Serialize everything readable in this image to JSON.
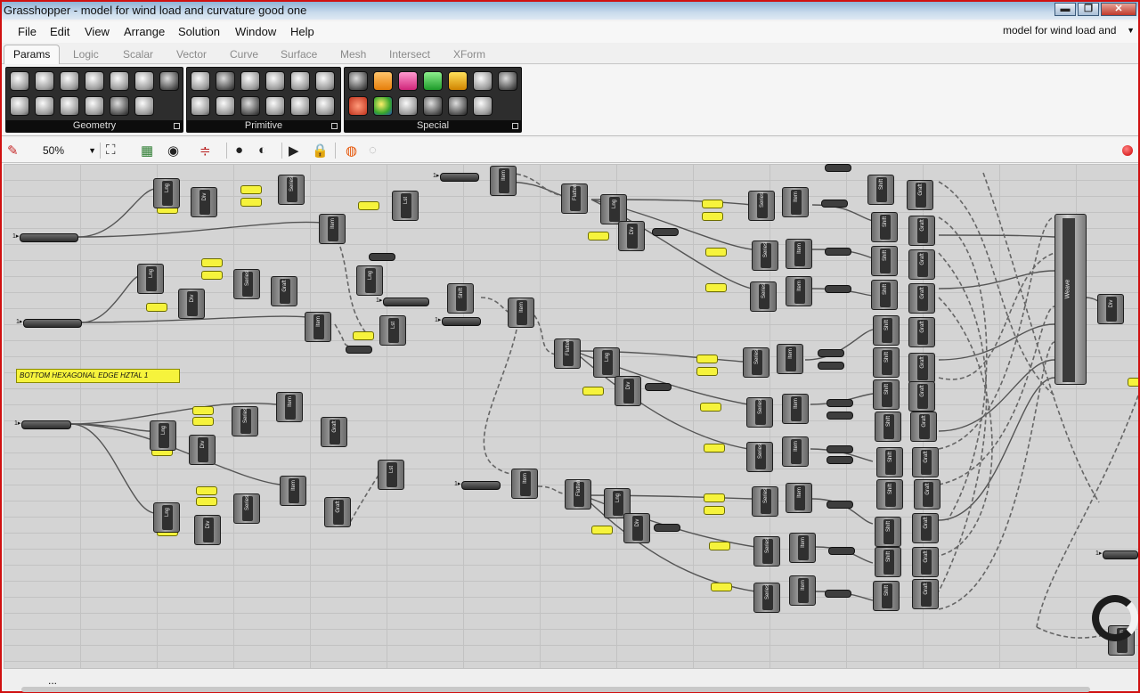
{
  "window": {
    "title": "Grasshopper - model for wind load and curvature good one",
    "buttons": {
      "minimize": "▬",
      "maximize": "❐",
      "close": "✕"
    }
  },
  "menu": {
    "items": [
      "File",
      "Edit",
      "View",
      "Arrange",
      "Solution",
      "Window",
      "Help"
    ],
    "document_selector": "model for wind load and"
  },
  "tabs": [
    "Params",
    "Logic",
    "Scalar",
    "Vector",
    "Curve",
    "Surface",
    "Mesh",
    "Intersect",
    "XForm"
  ],
  "active_tab": "Params",
  "ribbon": {
    "panels": [
      {
        "label": "Geometry",
        "icons": [
          "point-icon",
          "circle-icon",
          "arc-icon",
          "line-icon",
          "box-icon",
          "brep-icon",
          "vector-icon",
          "plane-icon",
          "curve-icon",
          "spiral-icon",
          "surface-icon",
          "x-icon",
          "mesh-icon"
        ]
      },
      {
        "label": "Primitive",
        "icons": [
          "boolean-icon",
          "integer-icon",
          "id-icon",
          "domain-icon",
          "complex-icon",
          "text-icon",
          "star-icon",
          "matrix-icon",
          "angle-icon",
          "shape-icon",
          "colour-icon",
          "time-icon"
        ]
      },
      {
        "label": "Special",
        "icons": [
          "graph-icon",
          "text-panel-icon",
          "slider-icon",
          "swatch-icon",
          "bar-chart-icon",
          "scribble-icon",
          "loop-icon",
          "colour-wheel-icon",
          "gradient-icon",
          "graph-mapper-icon",
          "import-icon",
          "tree-icon",
          "sketch-icon"
        ]
      }
    ]
  },
  "canvas_toolbar": {
    "zoom": "50%"
  },
  "canvas": {
    "group_label": "BOTTOM HEXAGONAL EDGE HZTAL 1",
    "node_labels": {
      "len": "Lng",
      "div": "Div",
      "series": "Series",
      "item": "Item",
      "flatten": "Flatten",
      "shift": "Shift",
      "graft": "Graft",
      "weave": "Weave",
      "list": "Lst",
      "shift_list": "Shift"
    }
  },
  "statusbar": {
    "text": "..."
  }
}
